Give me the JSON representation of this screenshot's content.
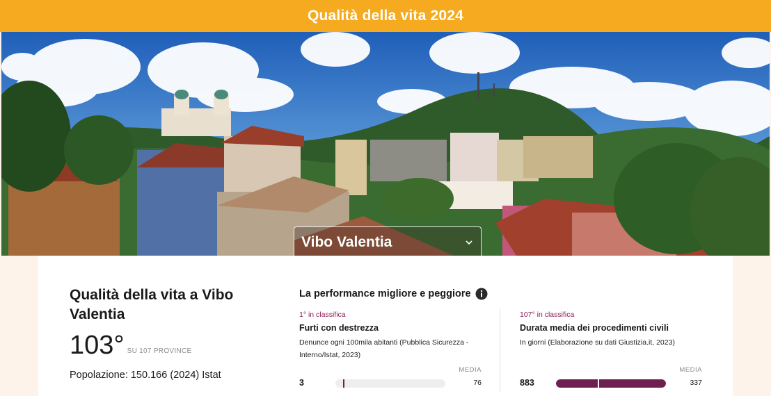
{
  "header": {
    "title": "Qualità della vita 2024"
  },
  "hero": {
    "selected_city": "Vibo Valentia",
    "chevron_icon": "chevron-down-icon"
  },
  "summary": {
    "title": "Qualità della vita a Vibo Valentia",
    "rank": "103°",
    "rank_suffix": "SU 107 PROVINCE",
    "population": "Popolazione: 150.166 (2024) Istat"
  },
  "performance": {
    "title": "La performance migliore e peggiore",
    "info_icon": "info-icon",
    "best": {
      "rank_label": "1° in classifica",
      "name": "Furti con destrezza",
      "description": "Denunce ogni 100mila abitanti (Pubblica Sicurezza - Interno/Istat, 2023)",
      "media_label": "MEDIA",
      "value": "3",
      "average": "76",
      "value_fraction": 0.01,
      "average_fraction": 0.07
    },
    "worst": {
      "rank_label": "107° in classifica",
      "name": "Durata media dei procedimenti civili",
      "description": "In giorni (Elaborazione su dati Giustizia.it, 2023)",
      "media_label": "MEDIA",
      "value": "883",
      "average": "337",
      "value_fraction": 1.0,
      "average_fraction": 0.38
    }
  },
  "colors": {
    "topbar": "#f5aa1f",
    "accent": "#6d1f52",
    "rank_text": "#8b1a58"
  }
}
